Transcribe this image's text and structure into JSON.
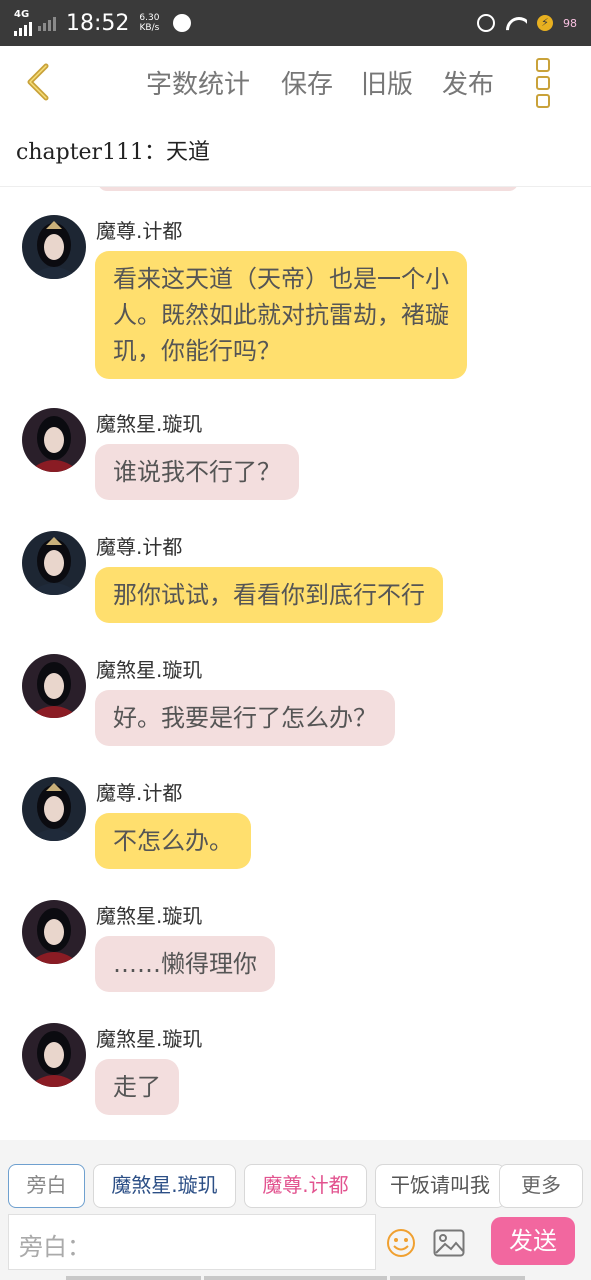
{
  "status_bar": {
    "network": "4G",
    "time": "18:52",
    "speed_value": "6.30",
    "speed_unit": "KB/s",
    "battery": "98"
  },
  "toolbar": {
    "word_count": "字数统计",
    "save": "保存",
    "old_version": "旧版",
    "publish": "发布"
  },
  "chapter_title": "chapter111：天道",
  "messages": [
    {
      "sender": "魔尊.计都",
      "text_lines": [
        "看来这天道（天帝）也是一个小",
        "人。既然如此就对抗雷劫，褚璇",
        "玑，你能行吗？"
      ],
      "color": "#ffdf6e"
    },
    {
      "sender": "魔煞星.璇玑",
      "text_lines": [
        "谁说我不行了？"
      ],
      "color": "#f3dede"
    },
    {
      "sender": "魔尊.计都",
      "text_lines": [
        "那你试试，看看你到底行不行"
      ],
      "color": "#ffdf6e"
    },
    {
      "sender": "魔煞星.璇玑",
      "text_lines": [
        "好。我要是行了怎么办？"
      ],
      "color": "#f3dede"
    },
    {
      "sender": "魔尊.计都",
      "text_lines": [
        "不怎么办。"
      ],
      "color": "#ffdf6e"
    },
    {
      "sender": "魔煞星.璇玑",
      "text_lines": [
        "……懒得理你"
      ],
      "color": "#f3dede"
    },
    {
      "sender": "魔煞星.璇玑",
      "text_lines": [
        "走了"
      ],
      "color": "#f3dede"
    }
  ],
  "role_chips": [
    {
      "label": "旁白",
      "color": "#888888"
    },
    {
      "label": "魔煞星.璇玑",
      "color": "#2c4f86"
    },
    {
      "label": "魔尊.计都",
      "color": "#e2538f"
    },
    {
      "label": "干饭请叫我",
      "color": "#555555"
    },
    {
      "label": "更多",
      "color": "#666666"
    }
  ],
  "composer": {
    "placeholder": "旁白：",
    "send": "发送"
  },
  "colors": {
    "accent_pink": "#f2679f",
    "bubble_yellow": "#ffdf6e",
    "bubble_pink": "#f3dede",
    "back_arrow": "#c9a23a"
  }
}
